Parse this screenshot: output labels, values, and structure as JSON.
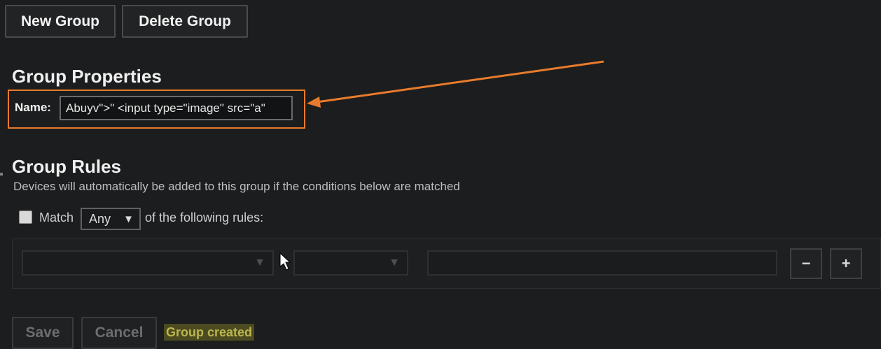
{
  "toolbar": {
    "new_group_label": "New Group",
    "delete_group_label": "Delete Group"
  },
  "properties": {
    "heading": "Group Properties",
    "name_label": "Name:",
    "name_value": "Abuyv\">\" <input type=\"image\" src=\"a\""
  },
  "rules": {
    "heading": "Group Rules",
    "description": "Devices will automatically be added to this group if the conditions below are matched",
    "match_label": "Match",
    "match_selected": "Any",
    "match_suffix": "of the following rules:",
    "remove_label": "−",
    "add_label": "+"
  },
  "footer": {
    "save_label": "Save",
    "cancel_label": "Cancel",
    "status_text": "Group created"
  },
  "colors": {
    "highlight": "#e87b2c",
    "status_bg": "#4c4a20",
    "status_text": "#b9b64f"
  }
}
